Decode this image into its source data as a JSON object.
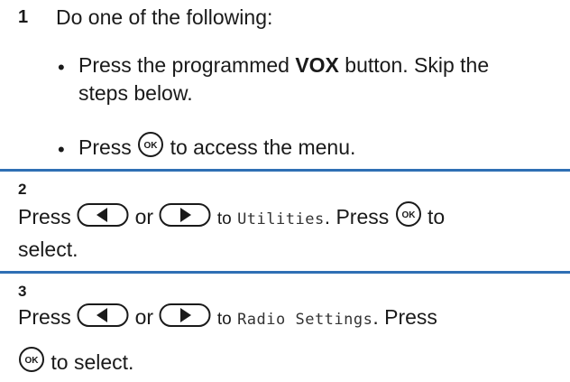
{
  "steps": [
    {
      "number": "1",
      "intro": "Do one of the following:",
      "options": [
        {
          "prefix": "Press the programmed ",
          "bold": "VOX",
          "suffix": " button. Skip the",
          "line2": "steps below."
        },
        {
          "prefix": "Press",
          "icon": "ok-button-icon",
          "suffix": "to access the menu."
        }
      ]
    },
    {
      "number": "2",
      "press": "Press",
      "or": "or",
      "to": "to",
      "menu_item": "Utilities",
      "press2": ". Press",
      "to2": "to",
      "line2": "select."
    },
    {
      "number": "3",
      "press": "Press",
      "or": "or",
      "to": "to",
      "menu_item": "Radio Settings",
      "press2": ". Press",
      "line2": "to select."
    }
  ],
  "icons": {
    "ok": "ok-button-icon",
    "left": "left-arrow-button-icon",
    "right": "right-arrow-button-icon"
  },
  "colors": {
    "divider": "#2f6fb4"
  }
}
